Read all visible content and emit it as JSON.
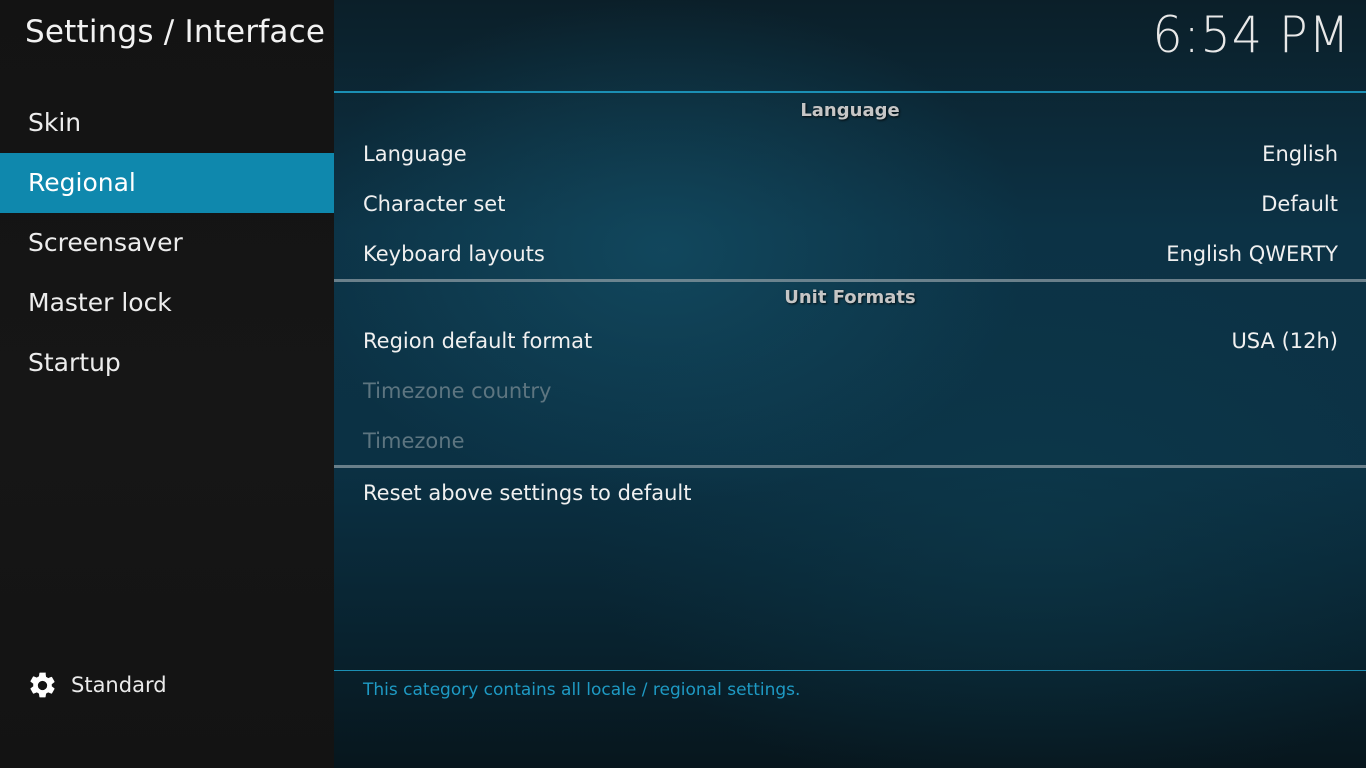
{
  "window": {
    "title": "Settings / Interface",
    "clock": "6:54 PM"
  },
  "sidebar": {
    "items": [
      {
        "label": "Skin",
        "active": false
      },
      {
        "label": "Regional",
        "active": true
      },
      {
        "label": "Screensaver",
        "active": false
      },
      {
        "label": "Master lock",
        "active": false
      },
      {
        "label": "Startup",
        "active": false
      }
    ],
    "settings_level": {
      "icon": "gear-icon",
      "label": "Standard"
    }
  },
  "main": {
    "sections": [
      {
        "header": "Language",
        "rows": [
          {
            "label": "Language",
            "value": "English",
            "enabled": true
          },
          {
            "label": "Character set",
            "value": "Default",
            "enabled": true
          },
          {
            "label": "Keyboard layouts",
            "value": "English QWERTY",
            "enabled": true
          }
        ]
      },
      {
        "header": "Unit Formats",
        "rows": [
          {
            "label": "Region default format",
            "value": "USA (12h)",
            "enabled": true
          },
          {
            "label": "Timezone country",
            "value": "",
            "enabled": false
          },
          {
            "label": "Timezone",
            "value": "",
            "enabled": false
          }
        ]
      }
    ],
    "reset_label": "Reset above settings to default",
    "description": "This category contains all locale / regional settings."
  },
  "colors": {
    "accent": "#0f88ad",
    "divider": "#1b8fb4",
    "description_text": "#1e9ac4",
    "disabled_text": "#5d7580"
  }
}
